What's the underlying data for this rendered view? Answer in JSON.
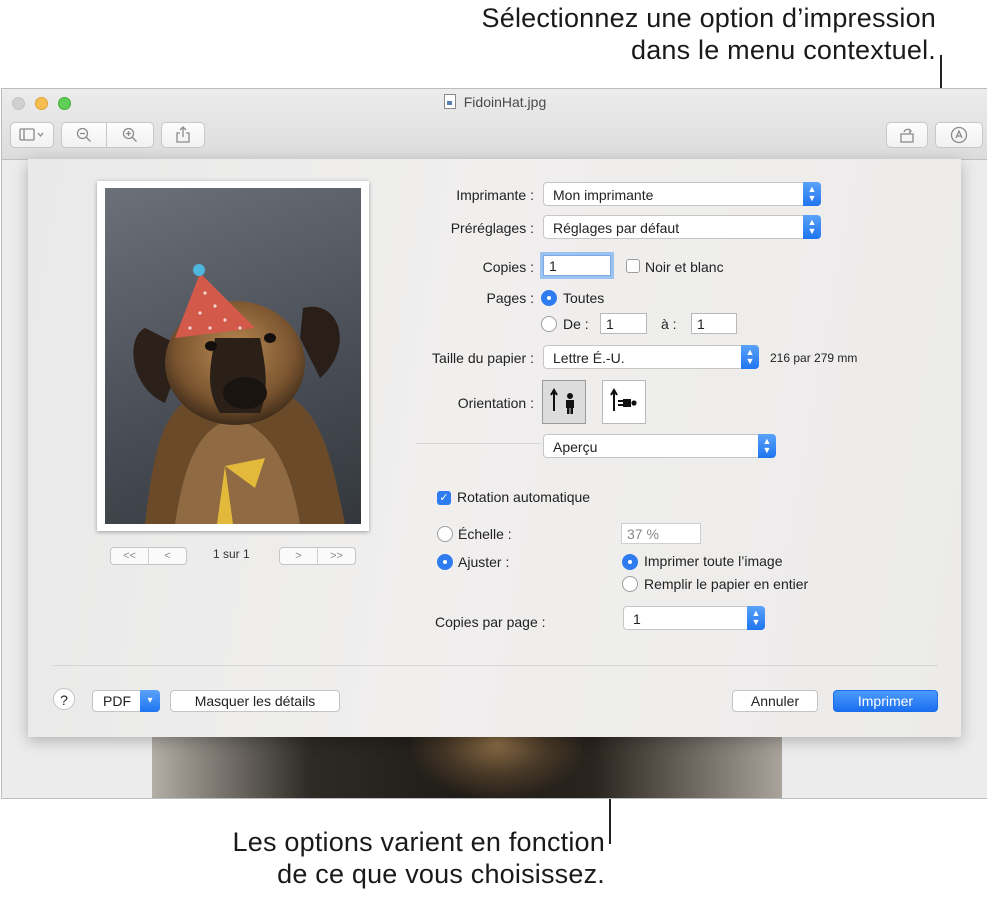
{
  "callouts": {
    "top_line1": "Sélectionnez une option d’impression",
    "top_line2": "dans le menu contextuel.",
    "bottom_line1": "Les options varient en fonction",
    "bottom_line2": "de ce que vous choisissez."
  },
  "window": {
    "title": "FidoinHat.jpg",
    "toolbar": [
      "sidebar-icon",
      "zoom-out-icon",
      "zoom-in-icon",
      "share-icon",
      "rotate-icon",
      "markup-icon"
    ]
  },
  "preview": {
    "page_label": "1 sur 1",
    "first": "<<",
    "prev": "<",
    "next": ">",
    "last": ">>"
  },
  "print": {
    "printer_label": "Imprimante :",
    "printer_value": "Mon imprimante",
    "presets_label": "Préréglages :",
    "presets_value": "Réglages par défaut",
    "copies_label": "Copies :",
    "copies_value": "1",
    "bw_label": "Noir et blanc",
    "pages_label": "Pages :",
    "pages_all": "Toutes",
    "pages_from": "De :",
    "pages_from_value": "1",
    "pages_to": "à :",
    "pages_to_value": "1",
    "paper_label": "Taille du papier :",
    "paper_value": "Lettre É.-U.",
    "paper_dims": "216 par 279 mm",
    "orientation_label": "Orientation :",
    "section_menu": "Aperçu",
    "auto_rotate": "Rotation automatique",
    "scale_label": "Échelle :",
    "scale_value": "37 %",
    "fit_label": "Ajuster :",
    "fit_whole": "Imprimer toute l’image",
    "fit_fill": "Remplir le papier en entier",
    "copies_per_page_label": "Copies par page :",
    "copies_per_page_value": "1"
  },
  "footer": {
    "help": "?",
    "pdf": "PDF",
    "hide_details": "Masquer les détails",
    "cancel": "Annuler",
    "print": "Imprimer"
  },
  "colors": {
    "accent": "#1f75f0"
  }
}
